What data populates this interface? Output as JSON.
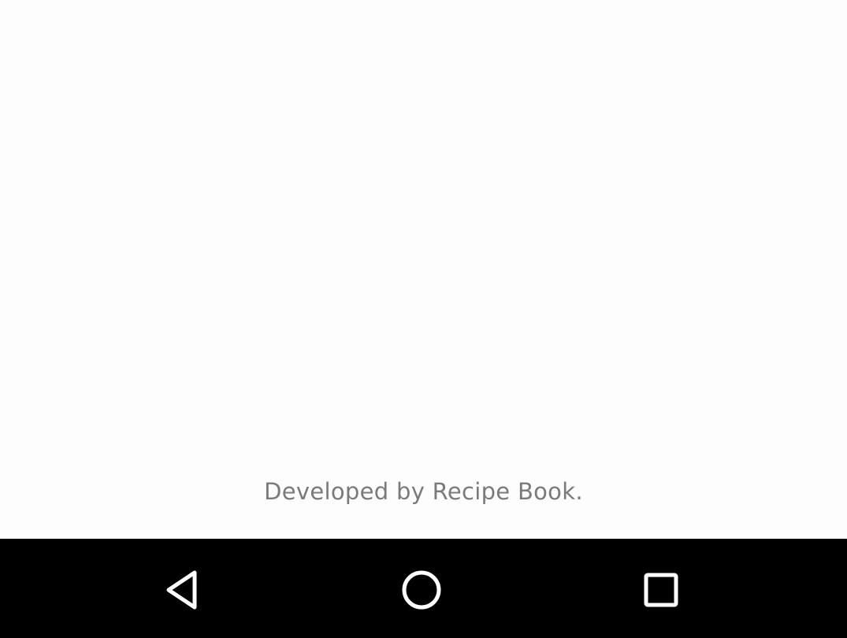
{
  "footer": {
    "credit_text": "Developed by Recipe Book."
  },
  "navigation_bar": {
    "background_color": "#000000",
    "icon_color": "#ffffff",
    "buttons": [
      {
        "name": "back",
        "icon": "back-triangle-icon"
      },
      {
        "name": "home",
        "icon": "home-circle-icon"
      },
      {
        "name": "recents",
        "icon": "recents-square-icon"
      }
    ]
  }
}
